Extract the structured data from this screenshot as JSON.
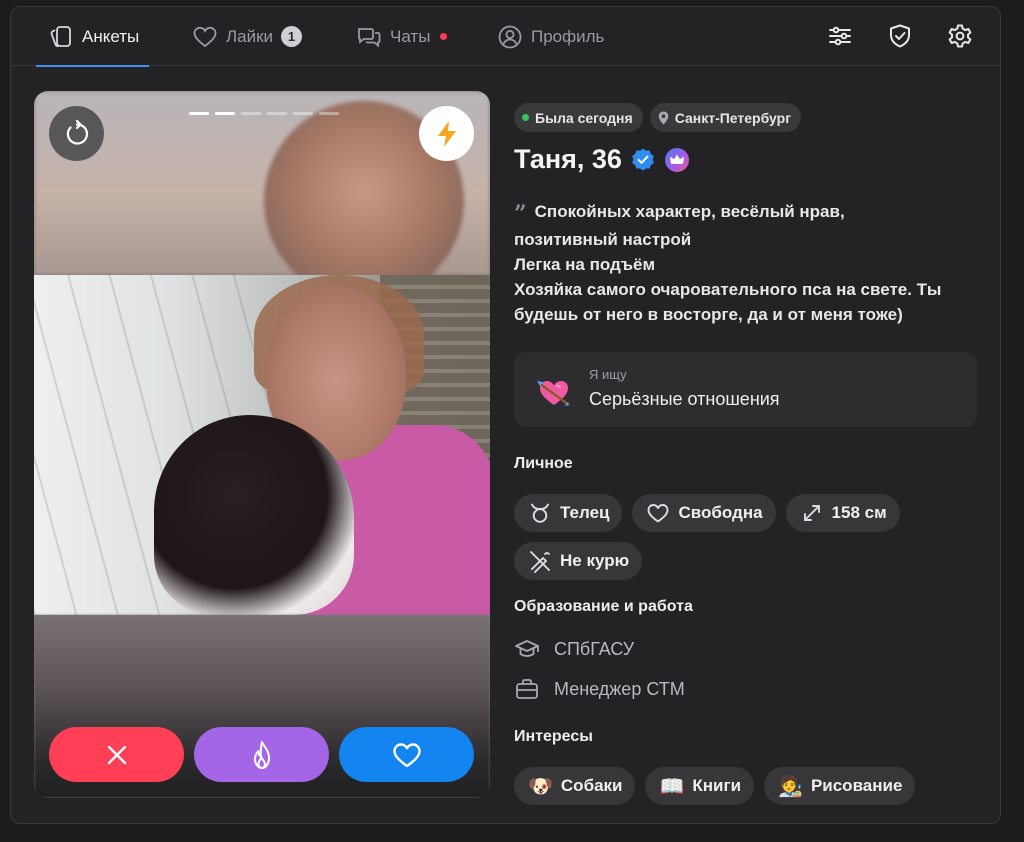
{
  "nav": {
    "tabs": [
      {
        "label": "Анкеты"
      },
      {
        "label": "Лайки",
        "count": "1"
      },
      {
        "label": "Чаты"
      },
      {
        "label": "Профиль"
      }
    ]
  },
  "photo": {
    "total_photos": 6,
    "current_photo": 2
  },
  "profile": {
    "status": "Была сегодня",
    "city": "Санкт-Петербург",
    "name_age": "Таня, 36",
    "bio": [
      "Спокойных характер, весёлый нрав,",
      "позитивный настрой",
      "Легка на подъём",
      "Хозяйка самого очаровательного пса на свете. Ты",
      "будешь от него в восторге, да и от меня тоже)"
    ],
    "looking_for_label": "Я ищу",
    "looking_for_value": "Серьёзные отношения"
  },
  "personal": {
    "title": "Личное",
    "items": [
      {
        "label": "Телец",
        "icon": "taurus-icon"
      },
      {
        "label": "Свободна",
        "icon": "heart-outline-icon"
      },
      {
        "label": "158 см",
        "icon": "expand-arrows-icon"
      },
      {
        "label": "Не курю",
        "icon": "no-smoking-icon"
      }
    ]
  },
  "education": {
    "title": "Образование и работа",
    "school": "СПбГАСУ",
    "job": "Менеджер СТМ"
  },
  "interests": {
    "title": "Интересы",
    "items": [
      {
        "label": "Собаки",
        "emoji": "🐶"
      },
      {
        "label": "Книги",
        "emoji": "📖"
      },
      {
        "label": "Рисование",
        "emoji": "🧑‍🎨"
      }
    ]
  },
  "colors": {
    "accent": "#3b8ff5",
    "dislike": "#ff3f55",
    "superlike": "#a466e6",
    "like": "#1384f0",
    "online": "#39c35c"
  }
}
